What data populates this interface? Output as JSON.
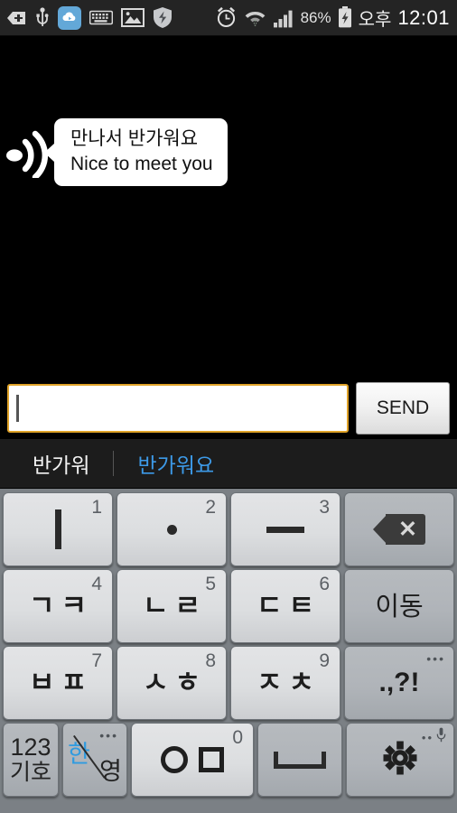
{
  "status_bar": {
    "icons": [
      {
        "name": "vpn-key-icon",
        "glyph": "➕"
      },
      {
        "name": "usb-icon",
        "glyph": "ᵭ9"
      },
      {
        "name": "cloud-sync-icon",
        "glyph": "☁"
      },
      {
        "name": "keyboard-icon",
        "glyph": "⌨"
      },
      {
        "name": "image-icon",
        "glyph": "ὛC"
      },
      {
        "name": "security-shield-icon",
        "glyph": "⛨"
      },
      {
        "name": "alarm-clock-icon",
        "glyph": "⏰"
      },
      {
        "name": "wifi-icon",
        "glyph": "὏6"
      },
      {
        "name": "signal-bars-icon",
        "glyph": "὏6"
      }
    ],
    "battery_percent": "86%",
    "ampm": "오후",
    "clock": "12:01"
  },
  "conversation": {
    "message": {
      "speaker_icon": "sound-wave-icon",
      "korean": "만나서 반가워요",
      "english": "Nice to meet you"
    }
  },
  "input_row": {
    "text_value": "",
    "placeholder": "",
    "send_label": "SEND",
    "border_color": "#dfa228"
  },
  "suggestions": {
    "items": [
      {
        "label": "반가워",
        "color": "#f2f2f2"
      },
      {
        "label": "반가워요",
        "color": "#3d9ae8"
      }
    ]
  },
  "keyboard": {
    "type": "cheonjiin",
    "rows": [
      {
        "keys": [
          {
            "name": "key-vowel-i",
            "glyph": "ㅣ",
            "num": "1",
            "style": "light"
          },
          {
            "name": "key-vowel-dot",
            "glyph": "·",
            "num": "2",
            "style": "light"
          },
          {
            "name": "key-vowel-eu",
            "glyph": "ㅡ",
            "num": "3",
            "style": "light"
          },
          {
            "name": "key-backspace",
            "glyph": "⌫",
            "num": "",
            "style": "dark"
          }
        ]
      },
      {
        "keys": [
          {
            "name": "key-giyeok-kieuk",
            "glyph": "ㄱㅋ",
            "num": "4",
            "style": "light"
          },
          {
            "name": "key-nieun-rieul",
            "glyph": "ㄴㄹ",
            "num": "5",
            "style": "light"
          },
          {
            "name": "key-digeut-tieut",
            "glyph": "ㄷㅌ",
            "num": "6",
            "style": "light"
          },
          {
            "name": "key-move",
            "glyph": "이동",
            "num": "",
            "style": "dark"
          }
        ]
      },
      {
        "keys": [
          {
            "name": "key-bieup-pieup",
            "glyph": "ㅂㅍ",
            "num": "7",
            "style": "light"
          },
          {
            "name": "key-siot-hieut",
            "glyph": "ㅅㅎ",
            "num": "8",
            "style": "light"
          },
          {
            "name": "key-jieut-chieut",
            "glyph": "ㅈㅊ",
            "num": "9",
            "style": "light"
          },
          {
            "name": "key-punctuation",
            "glyph": ".,?!",
            "num": "",
            "style": "dark",
            "dots": "•••"
          }
        ]
      },
      {
        "keys": [
          {
            "name": "key-numbers-symbols",
            "line1": "123",
            "line2": "기호",
            "style": "dark"
          },
          {
            "name": "key-language-toggle",
            "han": "한",
            "young": "영",
            "style": "dark",
            "dots": "•••",
            "han_color": "#2f9be0"
          },
          {
            "name": "key-ieung-mieum",
            "glyph": "ㅇㅁ",
            "num": "0",
            "style": "light"
          },
          {
            "name": "key-space",
            "glyph": "␣",
            "style": "dark"
          },
          {
            "name": "key-settings",
            "glyph": "⚙",
            "style": "dark",
            "hint_icon": "microphone-icon",
            "dots": "••"
          }
        ]
      }
    ]
  }
}
